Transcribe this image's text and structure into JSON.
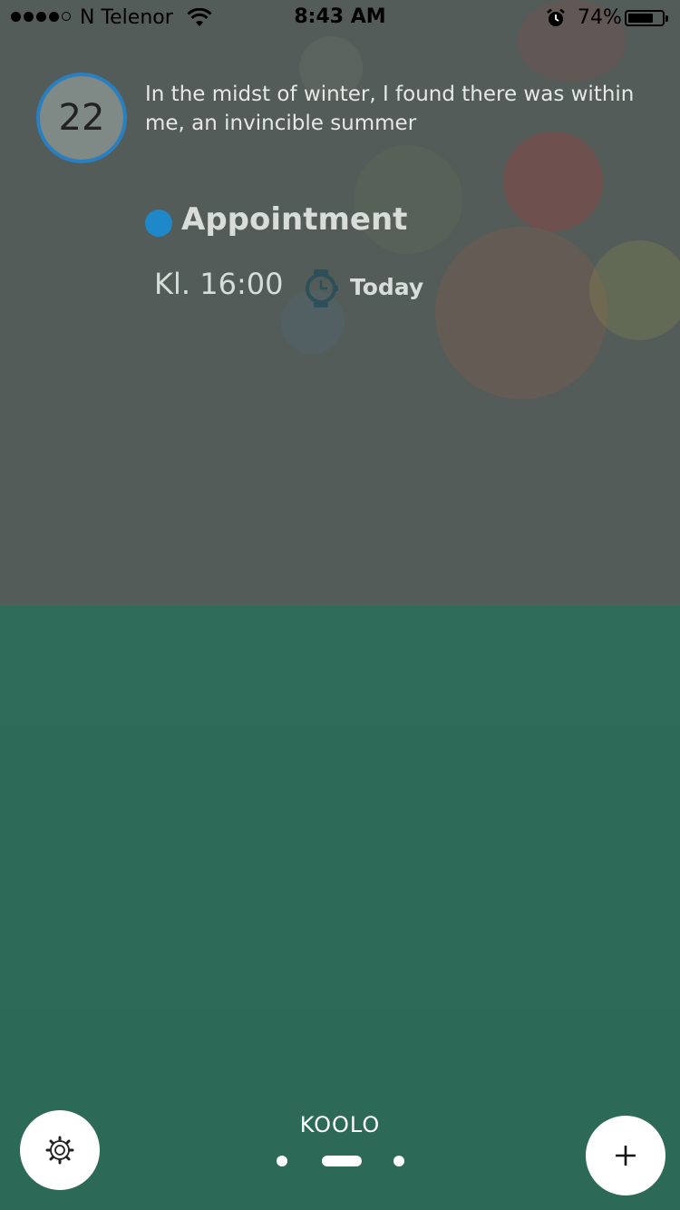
{
  "status_bar": {
    "carrier": "N Telenor",
    "time": "8:43 AM",
    "battery_percent": "74%",
    "battery_level": 0.74,
    "signal_bars": 4,
    "signal_total": 5
  },
  "header": {
    "day_number": "22",
    "quote": "In the midst of winter, I found there was within me, an invincible summer"
  },
  "event": {
    "title": "Appointment",
    "time": "Kl. 16:00",
    "day": "Today",
    "dot_color": "#1e88c8"
  },
  "footer": {
    "app_name": "KOOLO",
    "page_count": 3,
    "active_page": 1
  },
  "icons": {
    "settings": "gear-icon",
    "add": "plus-icon",
    "watch": "watch-icon"
  }
}
